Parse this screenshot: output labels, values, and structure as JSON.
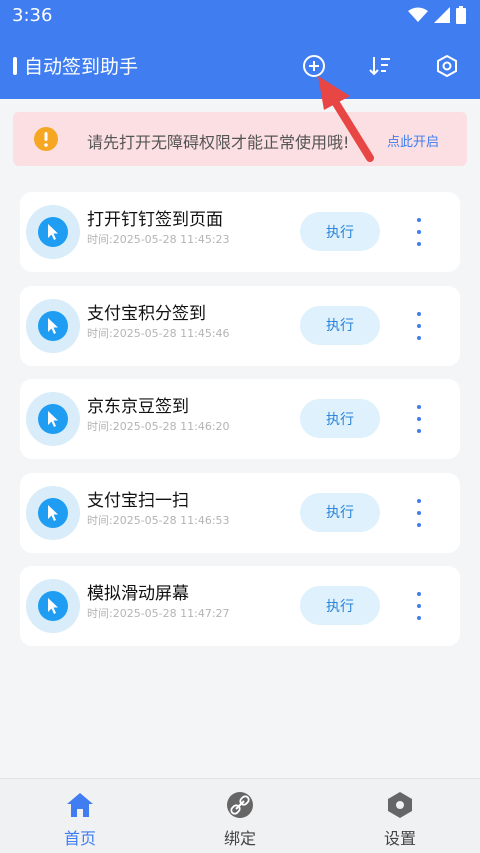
{
  "status_bar": {
    "time": "3:36"
  },
  "header": {
    "title": "自动签到助手",
    "icons": [
      "add-icon",
      "sort-icon",
      "settings-icon"
    ]
  },
  "notice": {
    "text": "请先打开无障碍权限才能正常使用哦!",
    "link_label": "点此开启"
  },
  "tasks": [
    {
      "title": "打开钉钉签到页面",
      "time": "时间:2025-05-28 11:45:23",
      "action_label": "执行"
    },
    {
      "title": "支付宝积分签到",
      "time": "时间:2025-05-28 11:45:46",
      "action_label": "执行"
    },
    {
      "title": "京东京豆签到",
      "time": "时间:2025-05-28 11:46:20",
      "action_label": "执行"
    },
    {
      "title": "支付宝扫一扫",
      "time": "时间:2025-05-28 11:46:53",
      "action_label": "执行"
    },
    {
      "title": "模拟滑动屏幕",
      "time": "时间:2025-05-28 11:47:27",
      "action_label": "执行"
    }
  ],
  "bottom_nav": [
    {
      "label": "首页",
      "icon": "home-icon",
      "active": true
    },
    {
      "label": "绑定",
      "icon": "link-icon",
      "active": false
    },
    {
      "label": "设置",
      "icon": "settings-icon",
      "active": false
    }
  ],
  "colors": {
    "primary": "#3f7df0",
    "notice_bg": "#fbdfe2",
    "warning": "#f5a623",
    "exec_bg": "#dff1fc",
    "arrow": "#e84545"
  }
}
